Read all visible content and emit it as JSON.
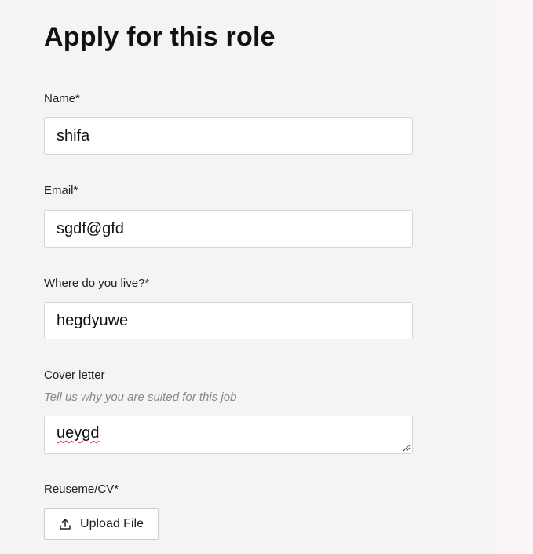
{
  "page": {
    "title": "Apply for this role"
  },
  "form": {
    "name": {
      "label": "Name*",
      "value": "shifa"
    },
    "email": {
      "label": "Email*",
      "value": "sgdf@gfd"
    },
    "location": {
      "label": "Where do you live?*",
      "value": "hegdyuwe"
    },
    "cover_letter": {
      "label": "Cover letter",
      "hint": "Tell us why you are suited for this job",
      "value": "ueygd"
    },
    "resume": {
      "label": "Reuseme/CV*",
      "button_label": "Upload File",
      "icon": "upload-icon"
    }
  }
}
